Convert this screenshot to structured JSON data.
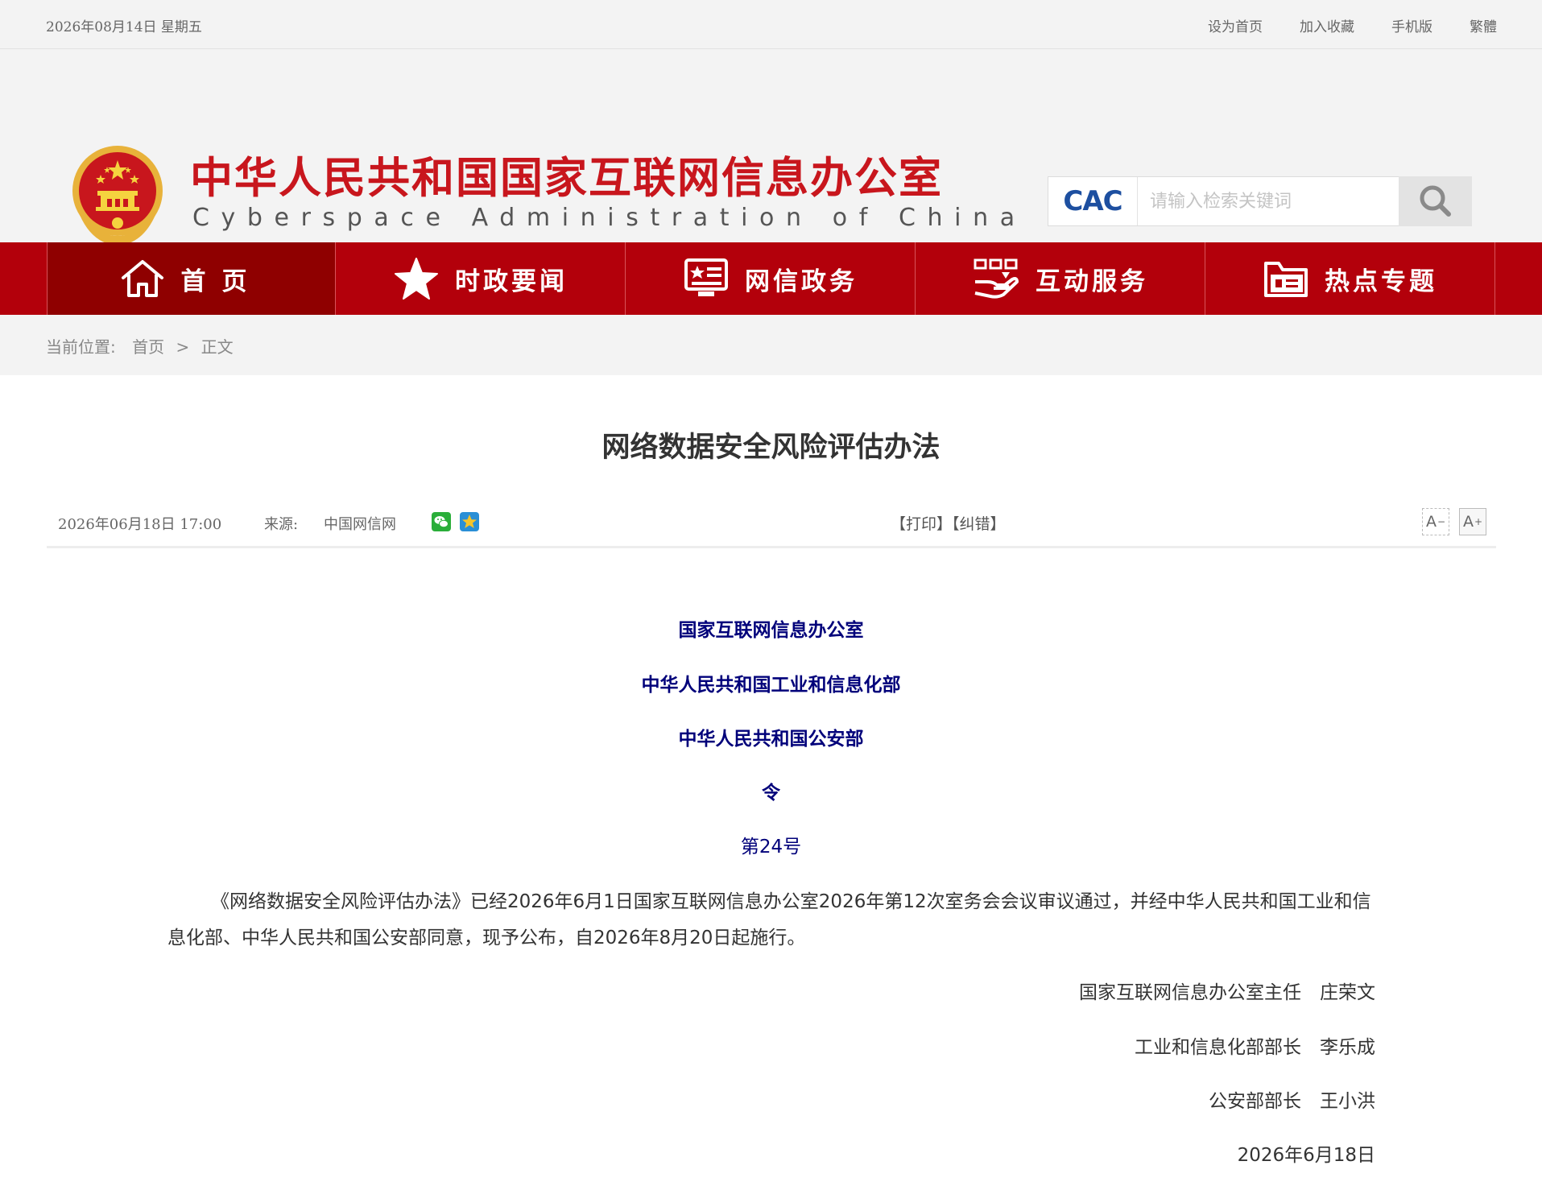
{
  "topbar": {
    "date": "2026年08月14日  星期五",
    "links": [
      "设为首页",
      "加入收藏",
      "手机版",
      "繁體"
    ]
  },
  "header": {
    "title": "中华人民共和国国家互联网信息办公室",
    "subtitle": "Cyberspace Administration of China",
    "search_placeholder": "请输入检索关键词",
    "search_logo": "CAC"
  },
  "nav": {
    "items": [
      {
        "label": "首页",
        "icon": "home-icon"
      },
      {
        "label": "时政要闻",
        "icon": "star-icon"
      },
      {
        "label": "网信政务",
        "icon": "monitor-icon"
      },
      {
        "label": "互动服务",
        "icon": "hand-service-icon"
      },
      {
        "label": "热点专题",
        "icon": "folder-icon"
      }
    ],
    "active_index": 0
  },
  "breadcrumb": {
    "label": "当前位置:",
    "home": "首页",
    "separator": ">",
    "current": "正文"
  },
  "article": {
    "title": "网络数据安全风险评估办法",
    "datetime": "2026年06月18日  17:00",
    "source_label": "来源:",
    "source": "中国网信网",
    "print": "【打印】",
    "correct": "【纠错】",
    "font_minus": "A",
    "font_plus": "A",
    "issuers": [
      "国家互联网信息办公室",
      "中华人民共和国工业和信息化部",
      "中华人民共和国公安部",
      "令"
    ],
    "order_number": "第24号",
    "body": "《网络数据安全风险评估办法》已经2026年6月1日国家互联网信息办公室2026年第12次室务会会议审议通过，并经中华人民共和国工业和信息化部、中华人民共和国公安部同意，现予公布，自2026年8月20日起施行。",
    "signatures": [
      "国家互联网信息办公室主任　庄荣文",
      "工业和信息化部部长　李乐成",
      "公安部部长　王小洪"
    ],
    "sign_date": "2026年6月18日"
  },
  "colors": {
    "brand_red": "#c8161d",
    "nav_red": "#b3000b",
    "nav_active": "#8f0000",
    "issuer_blue": "#00007a",
    "wechat_green": "#2aae3a"
  }
}
